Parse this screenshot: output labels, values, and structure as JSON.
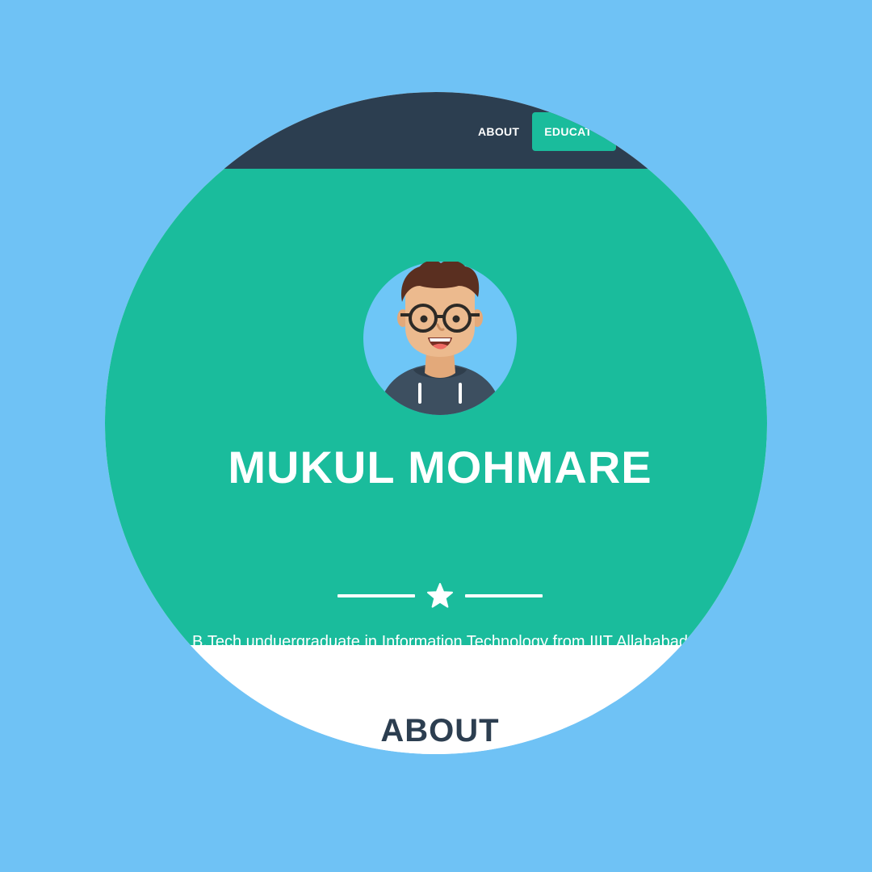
{
  "nav": {
    "items": [
      {
        "label": "ABOUT"
      },
      {
        "label": "EDUCAT"
      }
    ]
  },
  "masthead": {
    "avatar_icon": "avatar-icon",
    "title": "MUKUL MOHMARE",
    "divider_icon": "star-icon",
    "subtitle": "B.Tech unduergraduate in Information Technology from IIIT Allahabad"
  },
  "about": {
    "heading": "ABOUT"
  },
  "colors": {
    "background": "#6fc2f5",
    "navbar": "#2c3e50",
    "accent": "#1abc9c",
    "heading_text": "#2c3e50",
    "light_text": "#ffffff"
  }
}
